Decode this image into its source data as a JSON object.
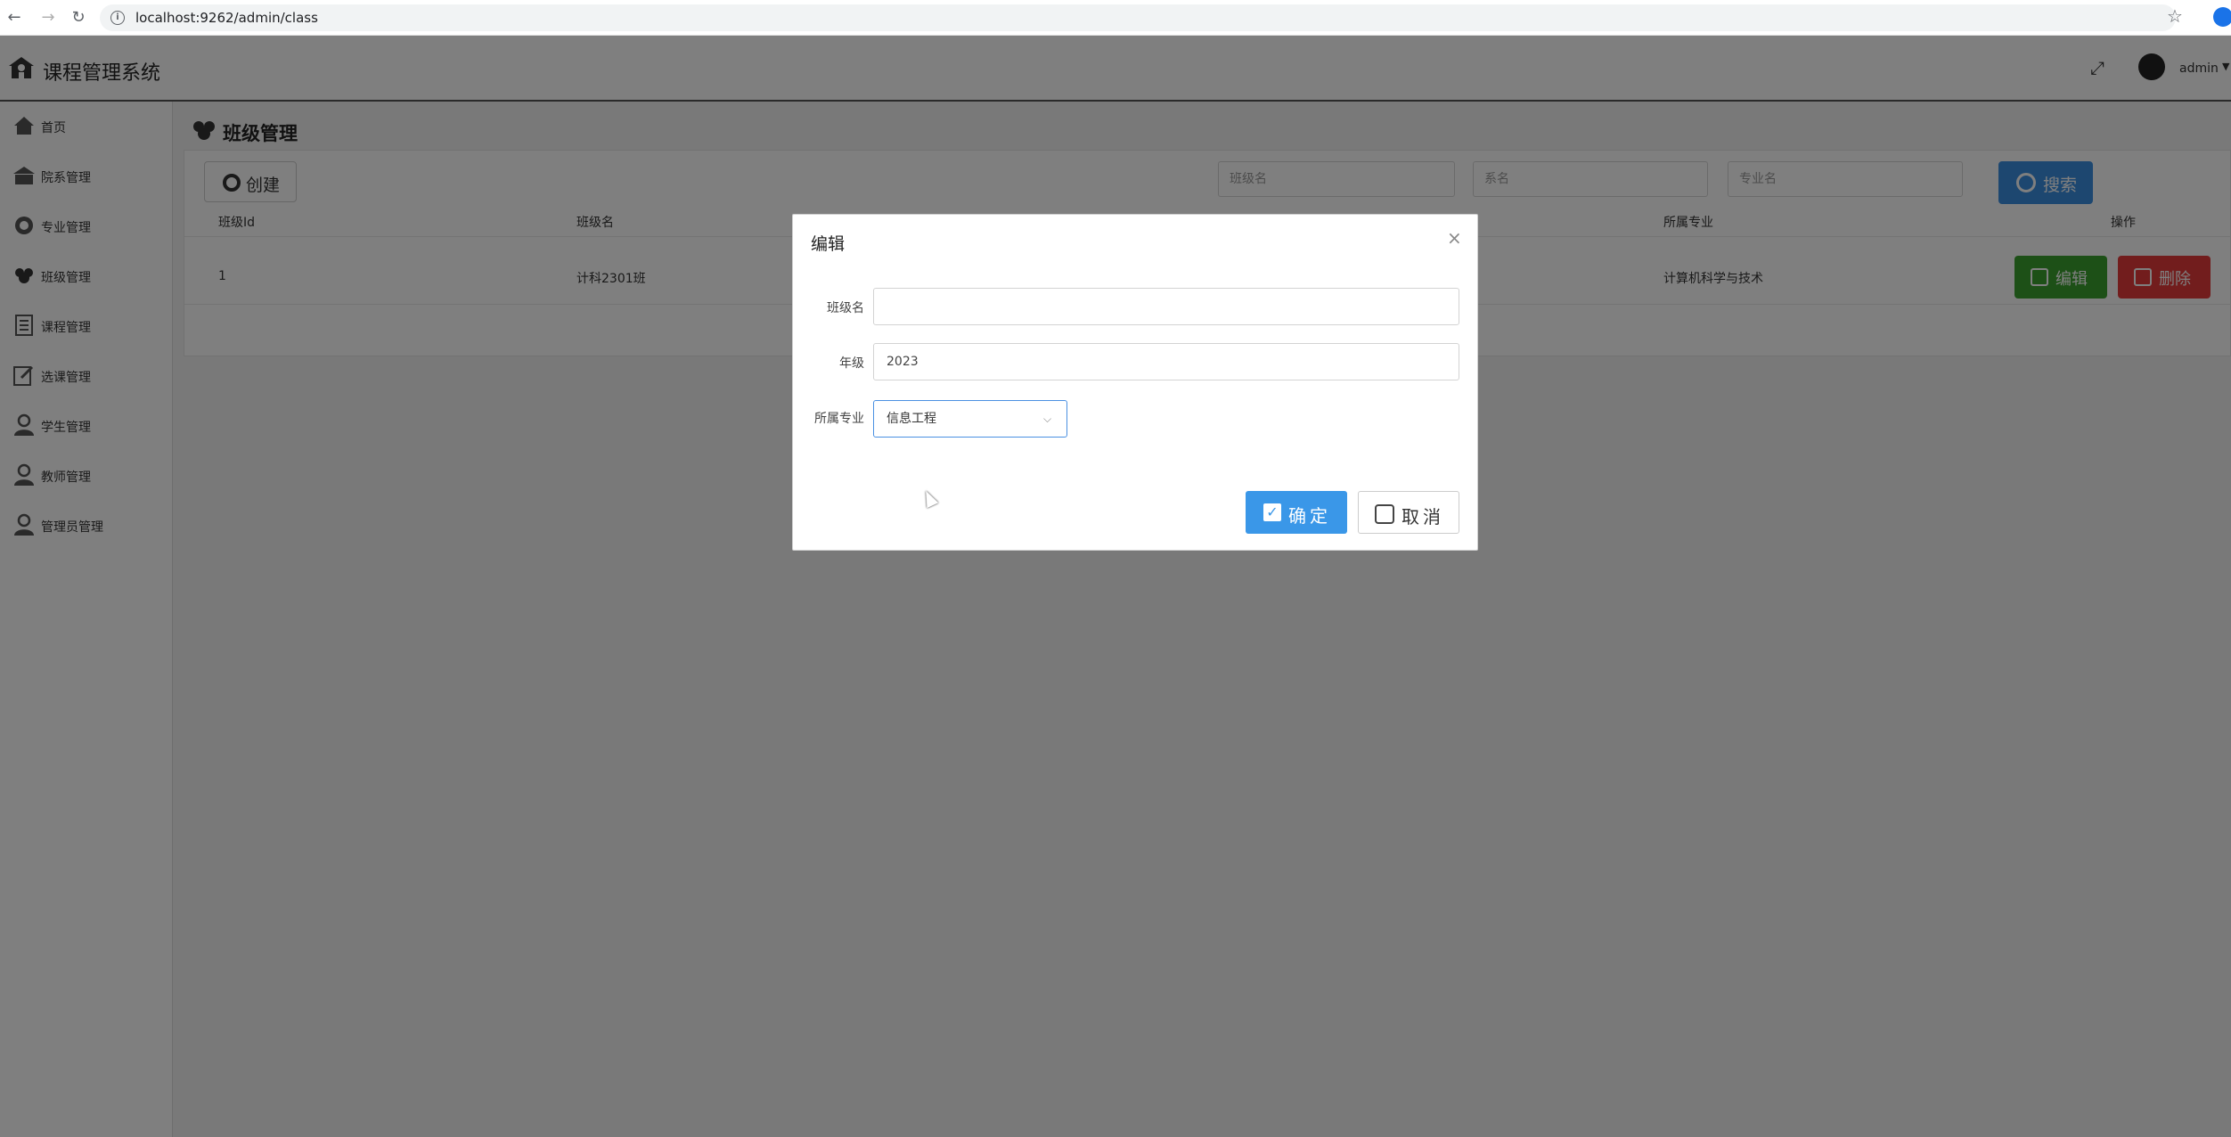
{
  "browser": {
    "url": "localhost:9262/admin/class"
  },
  "header": {
    "app_title": "课程管理系统",
    "user_name": "admin"
  },
  "sidebar": {
    "items": [
      {
        "label": "首页",
        "icon": "home-icon"
      },
      {
        "label": "院系管理",
        "icon": "college-icon"
      },
      {
        "label": "专业管理",
        "icon": "major-icon"
      },
      {
        "label": "班级管理",
        "icon": "class-icon"
      },
      {
        "label": "课程管理",
        "icon": "course-icon"
      },
      {
        "label": "选课管理",
        "icon": "select-course-icon"
      },
      {
        "label": "学生管理",
        "icon": "student-icon"
      },
      {
        "label": "教师管理",
        "icon": "teacher-icon"
      },
      {
        "label": "管理员管理",
        "icon": "admin-icon"
      }
    ]
  },
  "main": {
    "page_title": "班级管理",
    "create_label": "创建",
    "search": {
      "class_placeholder": "班级名",
      "college_placeholder": "系名",
      "major_placeholder": "专业名",
      "button_label": "搜索"
    },
    "table": {
      "headers": [
        "班级Id",
        "班级名",
        "所属专业",
        "操作"
      ],
      "rows": [
        {
          "id": "1",
          "name": "计科2301班",
          "major": "计算机科学与技术"
        }
      ],
      "edit_label": "编辑",
      "delete_label": "删除"
    }
  },
  "modal": {
    "title": "编辑",
    "close": "×",
    "fields": {
      "class_name_label": "班级名",
      "class_name_value": "",
      "grade_label": "年级",
      "grade_value": "2023",
      "major_label": "所属专业",
      "major_value": "信息工程"
    },
    "ok_label": "确定",
    "cancel_label": "取消"
  },
  "colors": {
    "primary": "#3a97e8",
    "success": "#3aa12e",
    "danger": "#e53a3a"
  }
}
